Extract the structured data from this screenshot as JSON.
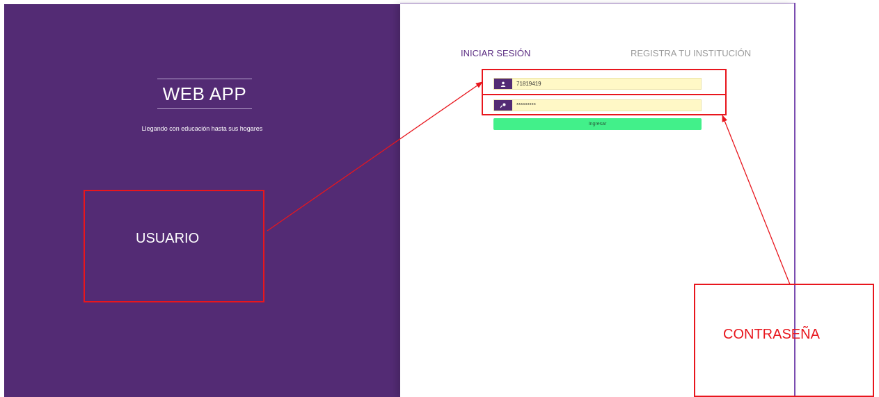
{
  "brand": {
    "title": "WEB APP",
    "tagline": "Llegando con educación hasta sus hogares"
  },
  "tabs": {
    "login": "INICIAR SESIÓN",
    "register": "REGISTRA TU INSTITUCIÓN"
  },
  "form": {
    "username_value": "71819419",
    "password_value": "*********",
    "submit_label": "Ingresar"
  },
  "annotations": {
    "user_label": "USUARIO",
    "password_label": "CONTRASEÑA"
  },
  "colors": {
    "brand_purple": "#532b74",
    "submit_green": "#42f08a",
    "annotation_red": "#e8161d",
    "autofill_yellow": "#fff8c6"
  },
  "icons": {
    "username": "user-icon",
    "password": "key-icon"
  }
}
